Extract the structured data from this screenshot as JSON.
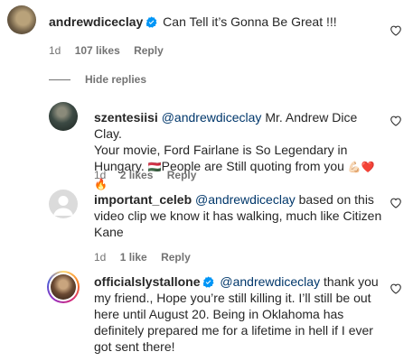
{
  "comments": [
    {
      "username": "andrewdiceclay",
      "verified": true,
      "text": "Can Tell it’s Gonna Be Great !!!",
      "time": "1d",
      "likes": "107 likes",
      "reply": "Reply"
    }
  ],
  "hide_replies_label": "Hide replies",
  "replies": [
    {
      "username": "szentesiisi",
      "mention": "@andrewdiceclay",
      "text_lines": [
        "Mr. Andrew Dice Clay.",
        "Your movie, Ford Fairlane is So Legendary in",
        "Hungary.",
        "People are Still quoting from you"
      ],
      "emojis": [
        "🇭🇺",
        "💪🏻",
        "❤️",
        "🔥"
      ],
      "time": "1d",
      "likes": "2 likes",
      "reply": "Reply"
    },
    {
      "username": "important_celeb",
      "mention": "@andrewdiceclay",
      "text_lines": [
        "based on this",
        "video clip we know it has walking, much like Citizen",
        "Kane"
      ],
      "time": "1d",
      "likes": "1 like",
      "reply": "Reply"
    },
    {
      "username": "officialslystallone",
      "verified": true,
      "mention": "@andrewdiceclay",
      "text_lines": [
        "thank you",
        "my friend., Hope you’re still killing it. I’ll still be out",
        "here until August 20. Being in Oklahoma has",
        "definitely prepared me for a lifetime in hell if I ever",
        "got sent there!"
      ]
    }
  ],
  "colors": {
    "text": "#262626",
    "meta": "#737373",
    "mention": "#00376b",
    "verified": "#0095f6",
    "ring": "#c13584"
  }
}
